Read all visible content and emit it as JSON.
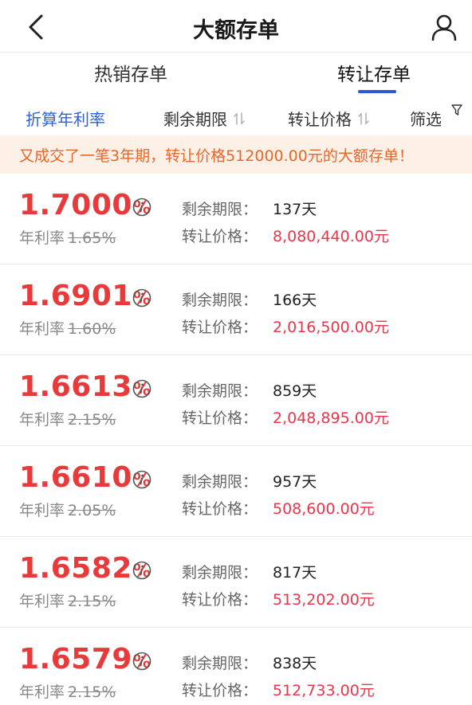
{
  "header": {
    "title": "大额存单"
  },
  "tabs": [
    {
      "label": "热销存单",
      "active": false
    },
    {
      "label": "转让存单",
      "active": true
    }
  ],
  "sort_bar": {
    "rate": "折算年利率",
    "term": "剩余期限",
    "price": "转让价格",
    "filter": "筛选"
  },
  "notice": "又成交了一笔3年期，转让价格512000.00元的大额存单！",
  "labels": {
    "year_rate": "年利率",
    "remaining": "剩余期限：",
    "price": "转让价格："
  },
  "colors": {
    "accent_blue": "#2c63d8",
    "rate_red": "#e83a3a",
    "price_red": "#e8374d",
    "notice_bg": "#fdf0e6",
    "notice_text": "#e8672a"
  },
  "items": [
    {
      "rate": "1.7000",
      "pct": "%",
      "orig_rate": "1.65%",
      "remaining": "137天",
      "price": "8,080,440.00元"
    },
    {
      "rate": "1.6901",
      "pct": "%",
      "orig_rate": "1.60%",
      "remaining": "166天",
      "price": "2,016,500.00元"
    },
    {
      "rate": "1.6613",
      "pct": "%",
      "orig_rate": "2.15%",
      "remaining": "859天",
      "price": "2,048,895.00元"
    },
    {
      "rate": "1.6610",
      "pct": "%",
      "orig_rate": "2.05%",
      "remaining": "957天",
      "price": "508,600.00元"
    },
    {
      "rate": "1.6582",
      "pct": "%",
      "orig_rate": "2.15%",
      "remaining": "817天",
      "price": "513,202.00元"
    },
    {
      "rate": "1.6579",
      "pct": "%",
      "orig_rate": "2.15%",
      "remaining": "838天",
      "price": "512,733.00元"
    }
  ]
}
